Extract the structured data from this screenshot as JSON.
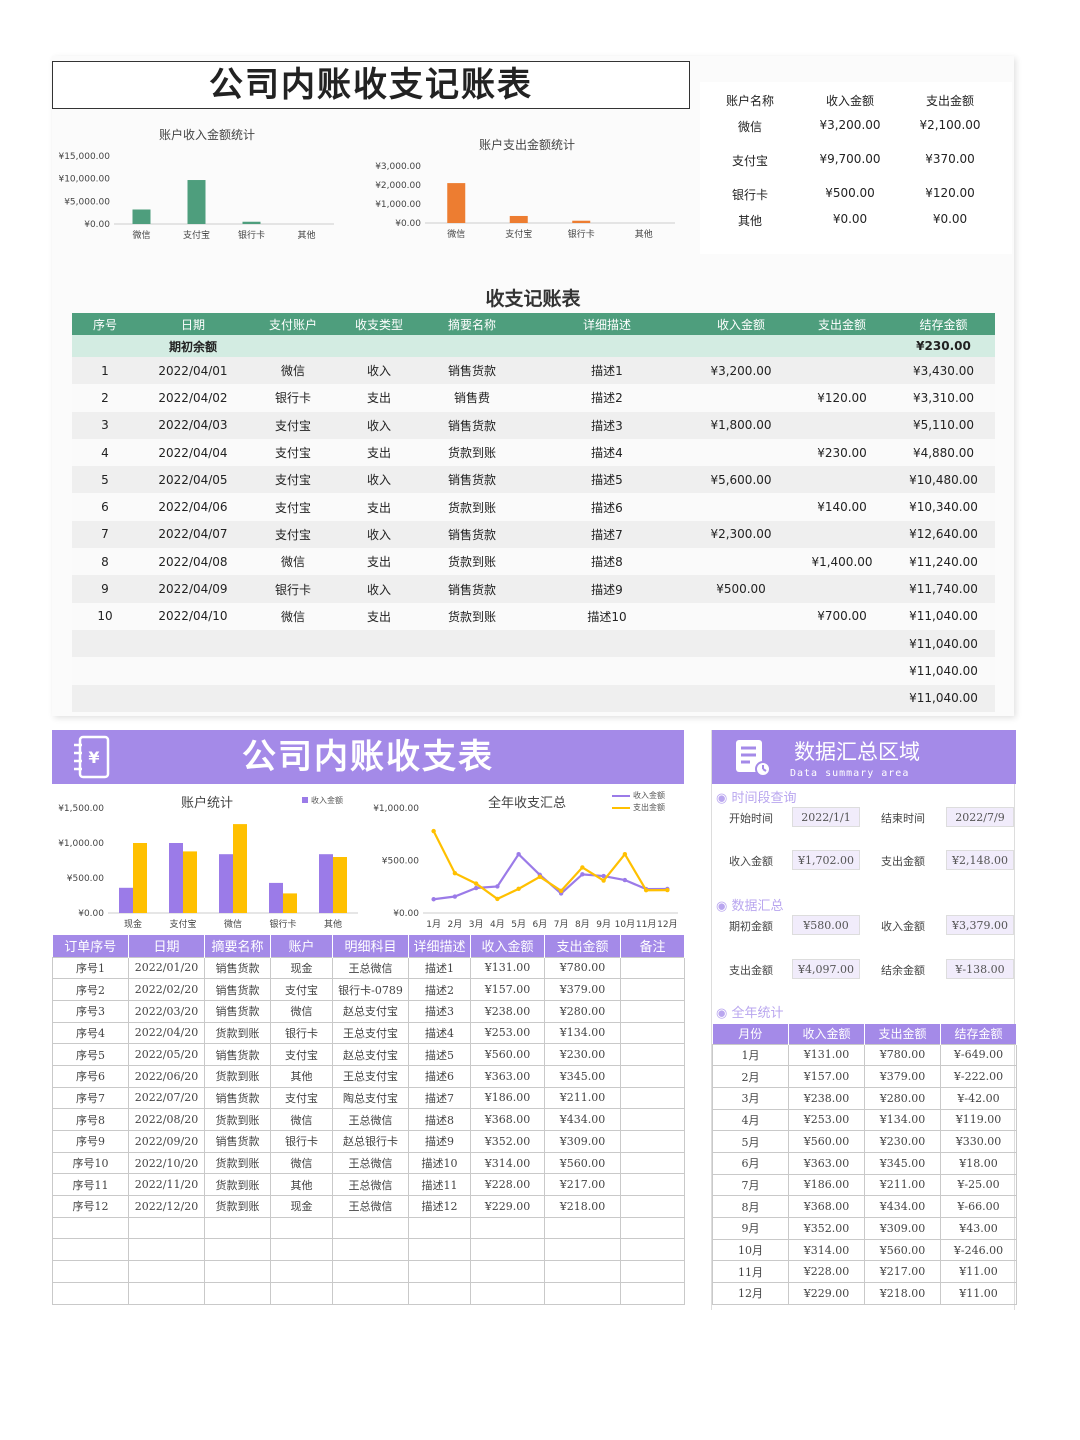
{
  "sheet1": {
    "title": "公司内账收支记账表",
    "income_chart_title": "账户收入金额统计",
    "expense_chart_title": "账户支出金额统计",
    "income_y_ticks": [
      "¥15,000.00",
      "¥10,000.00",
      "¥5,000.00",
      "¥0.00"
    ],
    "expense_y_ticks": [
      "¥3,000.00",
      "¥2,000.00",
      "¥1,000.00",
      "¥0.00"
    ],
    "summary": {
      "headers": [
        "账户名称",
        "收入金额",
        "支出金额"
      ],
      "rows": [
        [
          "微信",
          "¥3,200.00",
          "¥2,100.00"
        ],
        [
          "支付宝",
          "¥9,700.00",
          "¥370.00"
        ],
        [
          "银行卡",
          "¥500.00",
          "¥120.00"
        ],
        [
          "其他",
          "¥0.00",
          "¥0.00"
        ]
      ]
    },
    "ledger_title": "收支记账表",
    "ledger_headers": [
      "序号",
      "日期",
      "支付账户",
      "收支类型",
      "摘要名称",
      "详细描述",
      "收入金额",
      "支出金额",
      "结存金额"
    ],
    "opening_label": "期初余额",
    "opening_balance": "¥230.00",
    "ledger_rows": [
      [
        "1",
        "2022/04/01",
        "微信",
        "收入",
        "销售货款",
        "描述1",
        "¥3,200.00",
        "",
        "¥3,430.00"
      ],
      [
        "2",
        "2022/04/02",
        "银行卡",
        "支出",
        "销售费",
        "描述2",
        "",
        "¥120.00",
        "¥3,310.00"
      ],
      [
        "3",
        "2022/04/03",
        "支付宝",
        "收入",
        "销售货款",
        "描述3",
        "¥1,800.00",
        "",
        "¥5,110.00"
      ],
      [
        "4",
        "2022/04/04",
        "支付宝",
        "支出",
        "货款到账",
        "描述4",
        "",
        "¥230.00",
        "¥4,880.00"
      ],
      [
        "5",
        "2022/04/05",
        "支付宝",
        "收入",
        "销售货款",
        "描述5",
        "¥5,600.00",
        "",
        "¥10,480.00"
      ],
      [
        "6",
        "2022/04/06",
        "支付宝",
        "支出",
        "货款到账",
        "描述6",
        "",
        "¥140.00",
        "¥10,340.00"
      ],
      [
        "7",
        "2022/04/07",
        "支付宝",
        "收入",
        "销售货款",
        "描述7",
        "¥2,300.00",
        "",
        "¥12,640.00"
      ],
      [
        "8",
        "2022/04/08",
        "微信",
        "支出",
        "货款到账",
        "描述8",
        "",
        "¥1,400.00",
        "¥11,240.00"
      ],
      [
        "9",
        "2022/04/09",
        "银行卡",
        "收入",
        "销售货款",
        "描述9",
        "¥500.00",
        "",
        "¥11,740.00"
      ],
      [
        "10",
        "2022/04/10",
        "微信",
        "支出",
        "货款到账",
        "描述10",
        "",
        "¥700.00",
        "¥11,040.00"
      ],
      [
        "",
        "",
        "",
        "",
        "",
        "",
        "",
        "",
        "¥11,040.00"
      ],
      [
        "",
        "",
        "",
        "",
        "",
        "",
        "",
        "",
        "¥11,040.00"
      ],
      [
        "",
        "",
        "",
        "",
        "",
        "",
        "",
        "",
        "¥11,040.00"
      ]
    ]
  },
  "sheet2": {
    "title": "公司内账收支表",
    "bar_chart_title": "账户统计",
    "bar_legend": "收入金额",
    "bar_y_ticks": [
      "¥1,500.00",
      "¥1,000.00",
      "¥500.00",
      "¥0.00"
    ],
    "line_chart_title": "全年收支汇总",
    "line_legend": [
      "收入金额",
      "支出金额"
    ],
    "line_y_ticks": [
      "¥1,000.00",
      "¥500.00",
      "¥0.00"
    ],
    "headers": [
      "订单序号",
      "日期",
      "摘要名称",
      "账户",
      "明细科目",
      "详细描述",
      "收入金额",
      "支出金额",
      "备注"
    ],
    "rows": [
      [
        "序号1",
        "2022/01/20",
        "销售货款",
        "现金",
        "王总微信",
        "描述1",
        "¥131.00",
        "¥780.00",
        ""
      ],
      [
        "序号2",
        "2022/02/20",
        "销售货款",
        "支付宝",
        "银行卡-0789",
        "描述2",
        "¥157.00",
        "¥379.00",
        ""
      ],
      [
        "序号3",
        "2022/03/20",
        "销售货款",
        "微信",
        "赵总支付宝",
        "描述3",
        "¥238.00",
        "¥280.00",
        ""
      ],
      [
        "序号4",
        "2022/04/20",
        "货款到账",
        "银行卡",
        "王总支付宝",
        "描述4",
        "¥253.00",
        "¥134.00",
        ""
      ],
      [
        "序号5",
        "2022/05/20",
        "销售货款",
        "支付宝",
        "赵总支付宝",
        "描述5",
        "¥560.00",
        "¥230.00",
        ""
      ],
      [
        "序号6",
        "2022/06/20",
        "货款到账",
        "其他",
        "王总支付宝",
        "描述6",
        "¥363.00",
        "¥345.00",
        ""
      ],
      [
        "序号7",
        "2022/07/20",
        "销售货款",
        "支付宝",
        "陶总支付宝",
        "描述7",
        "¥186.00",
        "¥211.00",
        ""
      ],
      [
        "序号8",
        "2022/08/20",
        "货款到账",
        "微信",
        "王总微信",
        "描述8",
        "¥368.00",
        "¥434.00",
        ""
      ],
      [
        "序号9",
        "2022/09/20",
        "销售货款",
        "银行卡",
        "赵总银行卡",
        "描述9",
        "¥352.00",
        "¥309.00",
        ""
      ],
      [
        "序号10",
        "2022/10/20",
        "货款到账",
        "微信",
        "王总微信",
        "描述10",
        "¥314.00",
        "¥560.00",
        ""
      ],
      [
        "序号11",
        "2022/11/20",
        "货款到账",
        "其他",
        "王总微信",
        "描述11",
        "¥228.00",
        "¥217.00",
        ""
      ],
      [
        "序号12",
        "2022/12/20",
        "货款到账",
        "现金",
        "王总微信",
        "描述12",
        "¥229.00",
        "¥218.00",
        ""
      ],
      [
        "",
        "",
        "",
        "",
        "",
        "",
        "",
        "",
        ""
      ],
      [
        "",
        "",
        "",
        "",
        "",
        "",
        "",
        "",
        ""
      ],
      [
        "",
        "",
        "",
        "",
        "",
        "",
        "",
        "",
        ""
      ],
      [
        "",
        "",
        "",
        "",
        "",
        "",
        "",
        "",
        ""
      ]
    ]
  },
  "sheet3": {
    "title": "数据汇总区域",
    "subtitle": "Data summary area",
    "sec_time": "时间段查询",
    "start_label": "开始时间",
    "start_value": "2022/1/1",
    "end_label": "结束时间",
    "end_value": "2022/7/9",
    "income_label": "收入金额",
    "income_value": "¥1,702.00",
    "expense_label": "支出金额",
    "expense_value": "¥2,148.00",
    "sec_summary": "数据汇总",
    "open_label": "期初金额",
    "open_value": "¥580.00",
    "income2_label": "收入金额",
    "income2_value": "¥3,379.00",
    "expense2_label": "支出金额",
    "expense2_value": "¥4,097.00",
    "balance_label": "结余金额",
    "balance_value": "¥-138.00",
    "sec_year": "全年统计",
    "year_headers": [
      "月份",
      "收入金额",
      "支出金额",
      "结存金额"
    ],
    "year_rows": [
      [
        "1月",
        "¥131.00",
        "¥780.00",
        "¥-649.00"
      ],
      [
        "2月",
        "¥157.00",
        "¥379.00",
        "¥-222.00"
      ],
      [
        "3月",
        "¥238.00",
        "¥280.00",
        "¥-42.00"
      ],
      [
        "4月",
        "¥253.00",
        "¥134.00",
        "¥119.00"
      ],
      [
        "5月",
        "¥560.00",
        "¥230.00",
        "¥330.00"
      ],
      [
        "6月",
        "¥363.00",
        "¥345.00",
        "¥18.00"
      ],
      [
        "7月",
        "¥186.00",
        "¥211.00",
        "¥-25.00"
      ],
      [
        "8月",
        "¥368.00",
        "¥434.00",
        "¥-66.00"
      ],
      [
        "9月",
        "¥352.00",
        "¥309.00",
        "¥43.00"
      ],
      [
        "10月",
        "¥314.00",
        "¥560.00",
        "¥-246.00"
      ],
      [
        "11月",
        "¥228.00",
        "¥217.00",
        "¥11.00"
      ],
      [
        "12月",
        "¥229.00",
        "¥218.00",
        "¥11.00"
      ]
    ]
  },
  "chart_data": [
    {
      "type": "bar",
      "title": "账户收入金额统计",
      "categories": [
        "微信",
        "支付宝",
        "银行卡",
        "其他"
      ],
      "values": [
        3200,
        9700,
        500,
        0
      ],
      "ylim": [
        0,
        15000
      ],
      "color": "#4e9e7d"
    },
    {
      "type": "bar",
      "title": "账户支出金额统计",
      "categories": [
        "微信",
        "支付宝",
        "银行卡",
        "其他"
      ],
      "values": [
        2100,
        370,
        120,
        0
      ],
      "ylim": [
        0,
        3000
      ],
      "color": "#ed7d31"
    },
    {
      "type": "bar",
      "title": "账户统计",
      "categories": [
        "现金",
        "支付宝",
        "微信",
        "银行卡",
        "其他"
      ],
      "series": [
        {
          "name": "收入金额",
          "values": [
            360,
            1000,
            840,
            430,
            840
          ],
          "color": "#9b7be8"
        },
        {
          "name": "",
          "values": [
            1000,
            880,
            1270,
            280,
            800
          ],
          "color": "#ffc000"
        }
      ],
      "ylim": [
        0,
        1500
      ],
      "legend": "top-right"
    },
    {
      "type": "line",
      "title": "全年收支汇总",
      "categories": [
        "1月",
        "2月",
        "3月",
        "4月",
        "5月",
        "6月",
        "7月",
        "8月",
        "9月",
        "10月",
        "11月",
        "12月"
      ],
      "series": [
        {
          "name": "收入金额",
          "values": [
            131,
            157,
            238,
            253,
            560,
            363,
            186,
            368,
            352,
            314,
            228,
            229
          ],
          "color": "#9b7be8"
        },
        {
          "name": "支出金额",
          "values": [
            780,
            379,
            280,
            134,
            230,
            345,
            211,
            434,
            309,
            560,
            217,
            218
          ],
          "color": "#ffc000"
        }
      ],
      "ylim": [
        0,
        1000
      ],
      "legend": "top-right"
    }
  ]
}
